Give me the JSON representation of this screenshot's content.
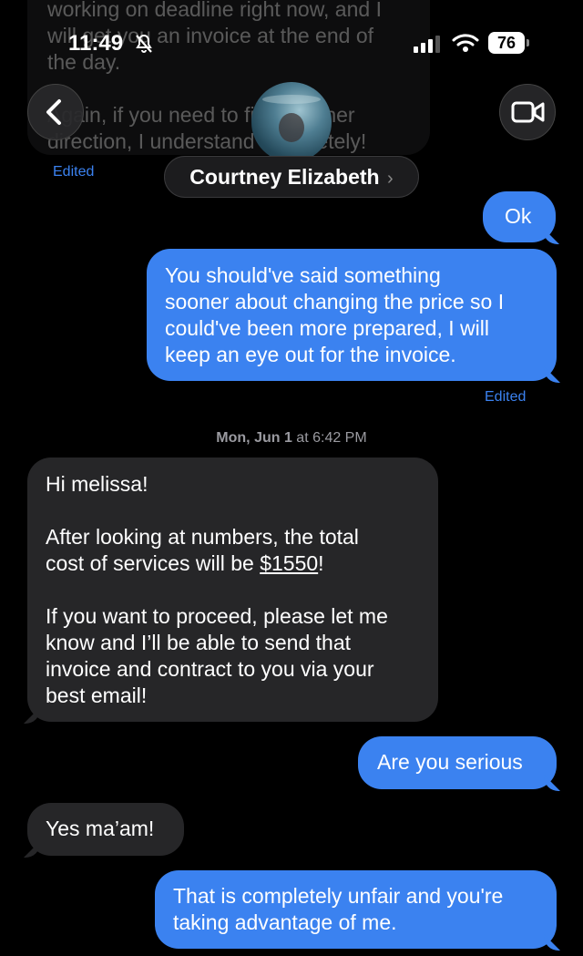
{
  "status_bar": {
    "time": "11:49",
    "battery": "76"
  },
  "header": {
    "contact_name": "Courtney Elizabeth",
    "chevron": "›"
  },
  "messages": [
    {
      "id": "m0",
      "direction": "in",
      "lines": [
        "working on deadline right now, and I",
        "will get you an invoice at the end of",
        "the day.",
        "",
        "Again, if you need to find another",
        "direction, I understand completely!"
      ],
      "edited": "Edited"
    },
    {
      "id": "m1",
      "direction": "out",
      "lines": [
        "Ok"
      ]
    },
    {
      "id": "m2",
      "direction": "out",
      "lines": [
        "You should've said something",
        "sooner about changing the price so I",
        "could've been more prepared, I will",
        "keep an eye out for the invoice."
      ],
      "edited": "Edited"
    },
    {
      "id": "ts",
      "timestamp_day": "Mon, Jun 1",
      "timestamp_at": " at 6:42 PM"
    },
    {
      "id": "m3",
      "direction": "in",
      "lines": [
        "Hi melissa!",
        "",
        "After looking at numbers, the total",
        "cost of services will be ",
        "",
        "If you want to proceed, please let me",
        "know and I’ll be able to send that",
        "invoice and contract to you via your",
        "best email!"
      ],
      "amount": "$1550",
      "amount_after": "!"
    },
    {
      "id": "m4",
      "direction": "out",
      "lines": [
        "Are you serious"
      ]
    },
    {
      "id": "m5",
      "direction": "in",
      "lines": [
        "Yes ma’am!"
      ]
    },
    {
      "id": "m6",
      "direction": "out",
      "lines": [
        "That is completely unfair and you're",
        "taking advantage of me."
      ]
    }
  ],
  "icons": {
    "back": "chevron-left-icon",
    "video": "video-camera-icon",
    "mute": "bell-slash-icon",
    "signal": "cellular-signal-icon",
    "wifi": "wifi-icon",
    "battery": "battery-icon"
  },
  "colors": {
    "outgoing_bubble": "#3b82f0",
    "incoming_bubble": "#262628",
    "background": "#000000",
    "edited_label": "#3b82f0"
  }
}
